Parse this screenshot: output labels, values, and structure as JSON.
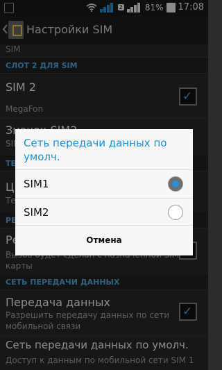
{
  "status_bar": {
    "sim_badge": "2",
    "battery": "81%",
    "time": "17:08",
    "icons": [
      "notification-icon",
      "wifi-icon",
      "signal-sim1-icon",
      "signal-sim2-icon",
      "battery-icon"
    ]
  },
  "action_bar": {
    "title": "Настройки SIM"
  },
  "background": {
    "top_partial": "SIM",
    "section_slot2": "СЛОТ 2 ДЛЯ SIM",
    "sim2_title": "SIM 2",
    "sim2_sub": "MegaFon",
    "sim_icon_title": "Значок SIM2",
    "sim_icon_sub": "SIM",
    "section_te": "ТЕ",
    "calls_title_partial": "Ц",
    "calls_sub_partial": "Те",
    "section_re": "РЕ",
    "re_title_partial": "Ре",
    "re_sub_line1": "Вызов будет сделан с назначенной SIM-",
    "re_sub_line2": "карты",
    "section_data": "СЕТЬ ПЕРЕДАЧИ ДАННЫХ",
    "data_title": "Передача данных",
    "data_sub_line1": "Разрешить передачу данных по сети",
    "data_sub_line2": "мобильной связи",
    "default_title": "Сеть передачи данных по умолч.",
    "default_sub": "Доступ к данным по мобильной сети SIM 1"
  },
  "dialog": {
    "title": "Сеть передачи данных по умолч.",
    "options": [
      {
        "label": "SIM1",
        "selected": true
      },
      {
        "label": "SIM2",
        "selected": false
      }
    ],
    "cancel": "Отмена"
  },
  "colors": {
    "accent": "#1a8ed8",
    "section": "#5ab0e5",
    "radio_selected": "#2f8fd6"
  }
}
